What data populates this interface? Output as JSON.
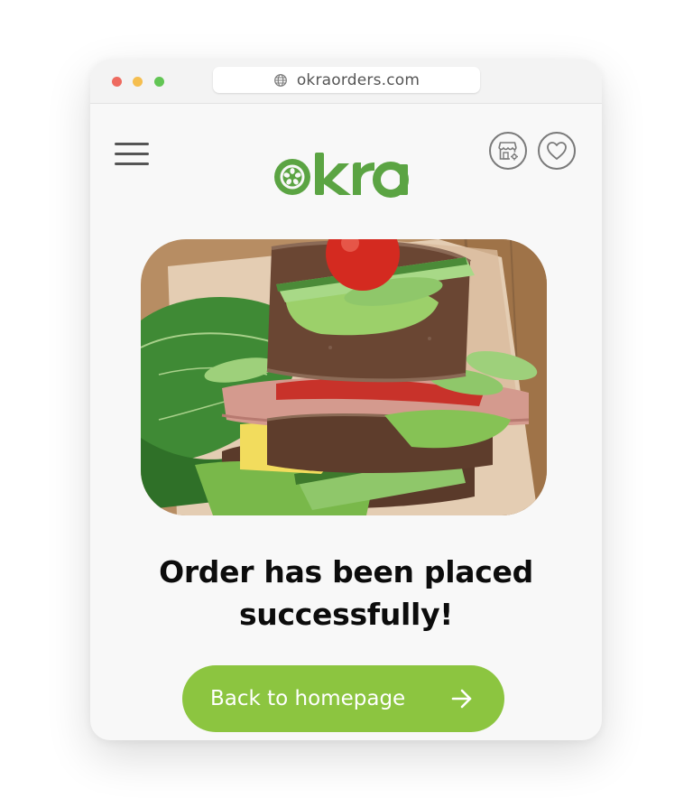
{
  "browser": {
    "url": "okraorders.com"
  },
  "header": {
    "logo_text": "okra",
    "menu_icon": "hamburger-menu-icon",
    "store_icon": "storefront-settings-icon",
    "favorites_icon": "heart-icon"
  },
  "hero": {
    "image_subject": "sandwich-photo"
  },
  "confirmation": {
    "line1": "Order has been placed",
    "line2": "successfully!"
  },
  "cta": {
    "label": "Back to homepage",
    "icon": "arrow-right-icon"
  },
  "colors": {
    "brand_green": "#5ba443",
    "button_green": "#8cc540",
    "text_dark": "#0c0c0c",
    "icon_gray": "#7a7a7a"
  }
}
